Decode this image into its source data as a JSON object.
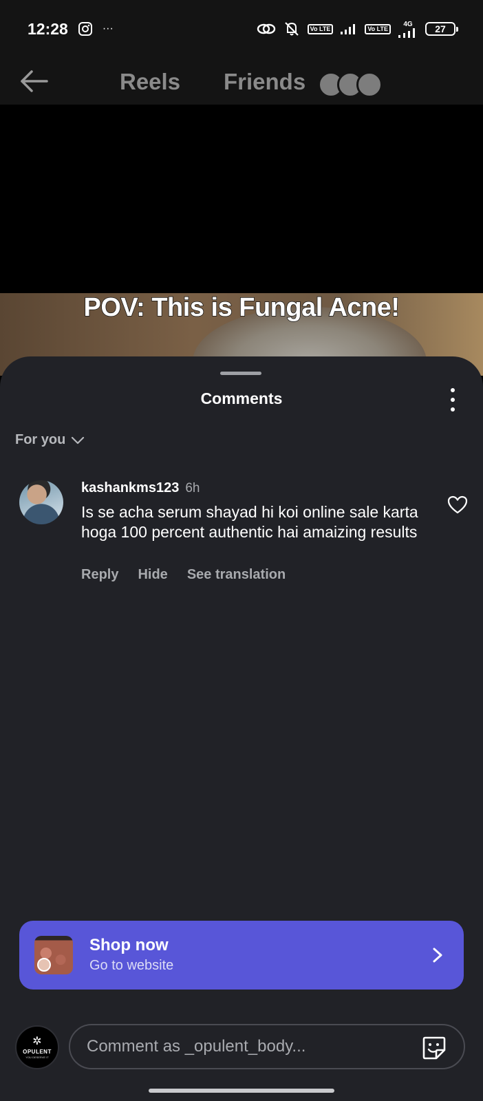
{
  "status_bar": {
    "time": "12:28",
    "more_icon": "···",
    "battery": "27",
    "network": "4G",
    "volte": "Vo LTE"
  },
  "nav": {
    "tabs": [
      {
        "label": "Reels",
        "active": false
      },
      {
        "label": "Friends",
        "active": false
      }
    ]
  },
  "video": {
    "caption": "POV: This is Fungal Acne!"
  },
  "comments_sheet": {
    "title": "Comments",
    "sort_label": "For you",
    "comments": [
      {
        "username": "kashankms123",
        "time": "6h",
        "text": "Is se acha serum shayad hi koi online sale karta hoga 100 percent authentic hai amaizing results",
        "actions": [
          "Reply",
          "Hide",
          "See translation"
        ]
      }
    ]
  },
  "shop_banner": {
    "title": "Shop now",
    "subtitle": "Go to website",
    "color": "#5856d8"
  },
  "composer": {
    "placeholder": "Comment as _opulent_body...",
    "brand_name": "OPULENT",
    "brand_tagline": "YOU DESERVE IT"
  },
  "colors": {
    "sheet_bg": "#212227",
    "accent": "#5856d8",
    "muted_text": "#a8aaae"
  }
}
